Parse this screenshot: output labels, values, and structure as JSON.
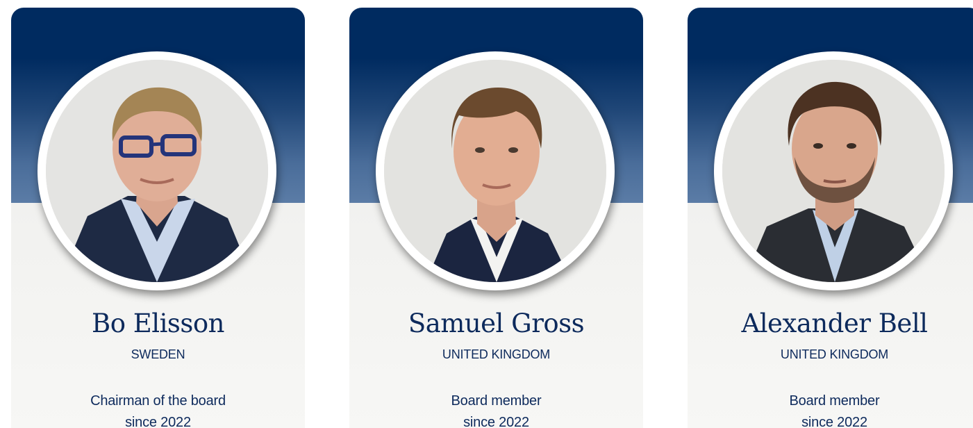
{
  "board_members": [
    {
      "name": "Bo Elisson",
      "country": "SWEDEN",
      "role": "Chairman of the board",
      "since": "since 2022",
      "photo": "portrait-photo"
    },
    {
      "name": "Samuel Gross",
      "country": "UNITED KINGDOM",
      "role": "Board member",
      "since": "since 2022",
      "photo": "portrait-photo"
    },
    {
      "name": "Alexander Bell",
      "country": "UNITED KINGDOM",
      "role": "Board member",
      "since": "since 2022",
      "photo": "portrait-photo"
    }
  ],
  "colors": {
    "banner_navy": "#002b60",
    "text_navy": "#0d2a5c",
    "card_background": "#f2f2f0"
  }
}
